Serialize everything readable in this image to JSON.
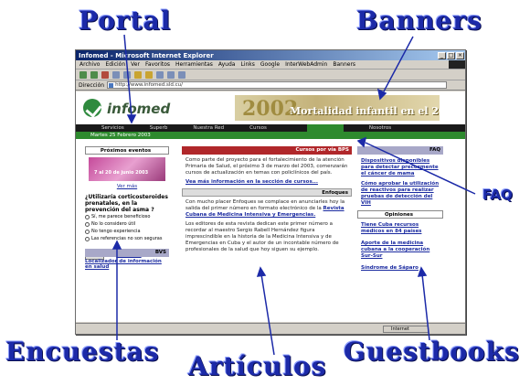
{
  "callouts": {
    "portal": "Portal",
    "banners": "Banners",
    "faq": "FAQ",
    "encuestas": "Encuestas",
    "articulos": "Artículos",
    "guestbooks": "Guestbooks"
  },
  "window": {
    "title": "Infomed - Microsoft Internet Explorer",
    "menu": [
      "Archivo",
      "Edición",
      "Ver",
      "Favoritos",
      "Herramientas",
      "Ayuda",
      "Links",
      "Google",
      "InterWebAdmin",
      "Banners"
    ],
    "address_label": "Dirección",
    "address_value": "http://www.infomed.sld.cu/",
    "status_zone": "Internet"
  },
  "page": {
    "logo_text": "infomed",
    "banner_number": "2002",
    "banner_text": "Mortalidad infantil en el 2002",
    "nav": [
      "Servicios",
      "Superb",
      "Nuestra Red",
      "Cursos",
      "",
      "Nosotros"
    ],
    "date": "Martes 25 Febrero 2003",
    "left": {
      "events_header": "Próximos eventos",
      "event_image_text": "7 al 20 de junio 2003",
      "see_more": "Ver más",
      "poll_question": "¿Utilizaría corticosteroides prenatales, en la prevención del asma ?",
      "poll_options": [
        "Sí, me parece beneficioso",
        "No lo considero útil",
        "No tengo experiencia",
        "Las referencias no son seguras"
      ],
      "vote_button": "Votar",
      "results_link": "Resultados",
      "bvs_header": "BVS",
      "bvs_link": "Localizador de información en salud"
    },
    "mid": {
      "courses_header": "Cursos por vía BPS",
      "courses_text": "Como parte del proyecto para el fortalecimiento de la atención Primaria de Salud, el próximo 3 de marzo del 2003, comenzarán cursos de actualización en temas con policlínicos del país.",
      "courses_link": "Vea más información en la sección de cursos...",
      "focus_header": "Enfoques",
      "focus_text1": "Con mucho placer Enfoques se complace en anunciarles hoy la salida del primer número en formato electrónico de la",
      "focus_link": "Revista Cubana de Medicina Intensiva y Emergencias.",
      "focus_text2": "Los editores de esta revista dedican este primer número a recordar al maestro Sergio Rabell Hernández figura imprescindible en la historia de la Medicina Intensiva y de Emergencias en Cuba y el autor de un incontable número de profesionales de la salud que hoy siguen su ejemplo."
    },
    "right": {
      "faq_header": "FAQ",
      "faq_items": [
        "Dispositivos disponibles para detectar precozmente el cáncer de mama",
        "Cómo aprobar la utilización de reactivos para realizar pruebas de detección del VIH"
      ],
      "opinions_header": "Opiniones",
      "opinion_items": [
        "Tiene Cuba recursos médicos en 84 países",
        "Aporte de la medicina cubana a la cooperación Sur-Sur",
        "Síndrome de Sáparo"
      ]
    }
  }
}
